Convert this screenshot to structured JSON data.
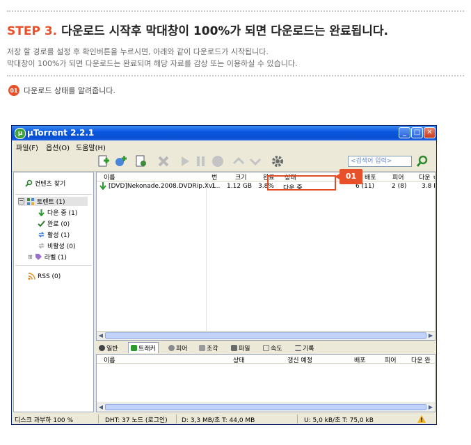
{
  "header": {
    "step_number": "STEP 3.",
    "step_title": "다운로드 시작후 막대창이 100%가 되면 다운로드는 완료됩니다.",
    "desc_line1": "저장 할 경로를 설정 후 확인버튼을 누르시면, 아래와 같이 다운로드가 시작됩니다.",
    "desc_line2": "막대창이 100%가 되면 다운로드는 완료되며 해당 자료를 감상 또는 이용하실 수 있습니다.",
    "note_badge": "01",
    "note_text": "다운로드 상태를 알려줍니다."
  },
  "window": {
    "title": "μTorrent 2.2.1",
    "min": "_",
    "max": "□",
    "close": "✕"
  },
  "menu": [
    "파일(F)",
    "옵션(O)",
    "도움말(H)"
  ],
  "search": {
    "placeholder": "<검색어 입력>"
  },
  "sidebar": {
    "find_content": "컨텐츠 찾기",
    "torrents": "토렌트 (1)",
    "downloading": "다운 중 (1)",
    "completed": "완료 (0)",
    "active": "활성 (1)",
    "inactive": "비활성 (0)",
    "labels": "라벨 (1)",
    "rss": "RSS (0)"
  },
  "list": {
    "columns": [
      "이름",
      "번",
      "크기",
      "완료",
      "상태",
      "배포",
      "피어",
      "다운 ㅎ"
    ],
    "row": {
      "name": "[DVD]Nekonade.2008.DVDRip.Xvi...",
      "num": "1",
      "size": "1.12 GB",
      "done": "3.8%",
      "status": "다운 중",
      "seeds": "6 (11)",
      "peers": "2 (8)",
      "down": "3.8 N"
    }
  },
  "callout": "01",
  "tabs": [
    "일반",
    "트래커",
    "피어",
    "조각",
    "파일",
    "속도",
    "기록"
  ],
  "detail_columns": [
    "이름",
    "상태",
    "갱신 예정",
    "배포",
    "피어",
    "다운 완"
  ],
  "status": {
    "disk": "디스크 과부하 100 %",
    "dht": "DHT: 37 노드  (로그인)",
    "down": "D: 3,3 MB/초 T: 44,0 MB",
    "up": "U: 5,0 kB/초 T: 75,0 kB"
  },
  "colors": {
    "accent": "#e8502a",
    "titlebar": "#0a58e0",
    "window": "#ece9d8"
  }
}
